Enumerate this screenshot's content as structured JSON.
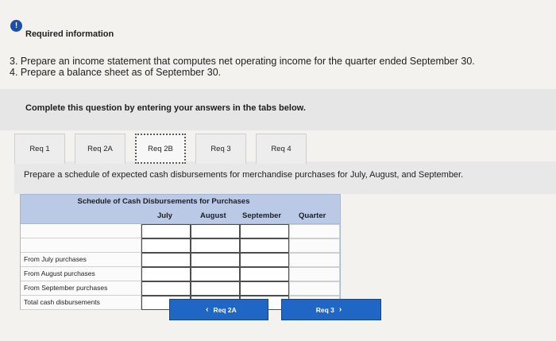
{
  "header": {
    "required_info": "Required information"
  },
  "instructions": [
    "3. Prepare an income statement that computes net operating income for the quarter ended September 30.",
    "4. Prepare a balance sheet as of September 30."
  ],
  "panel_title": "Complete this question by entering your answers in the tabs below.",
  "tabs": [
    {
      "label": "Req 1"
    },
    {
      "label": "Req 2A"
    },
    {
      "label": "Req 2B"
    },
    {
      "label": "Req 3"
    },
    {
      "label": "Req 4"
    }
  ],
  "active_tab": "Req 2B",
  "prompt": "Prepare a schedule of expected cash disbursements for merchandise purchases for July, August, and September.",
  "table": {
    "title": "Schedule of Cash Disbursements for Purchases",
    "columns": [
      "July",
      "August",
      "September",
      "Quarter"
    ],
    "rows": [
      {
        "label": "From July purchases"
      },
      {
        "label": "From August purchases"
      },
      {
        "label": "From September purchases"
      },
      {
        "label": "Total cash disbursements"
      }
    ]
  },
  "nav": {
    "prev_label": "Req 2A",
    "next_label": "Req 3"
  },
  "colors": {
    "accent": "#1f66c5",
    "table_header": "#b9c9e6",
    "info_icon": "#1d4fa8"
  }
}
